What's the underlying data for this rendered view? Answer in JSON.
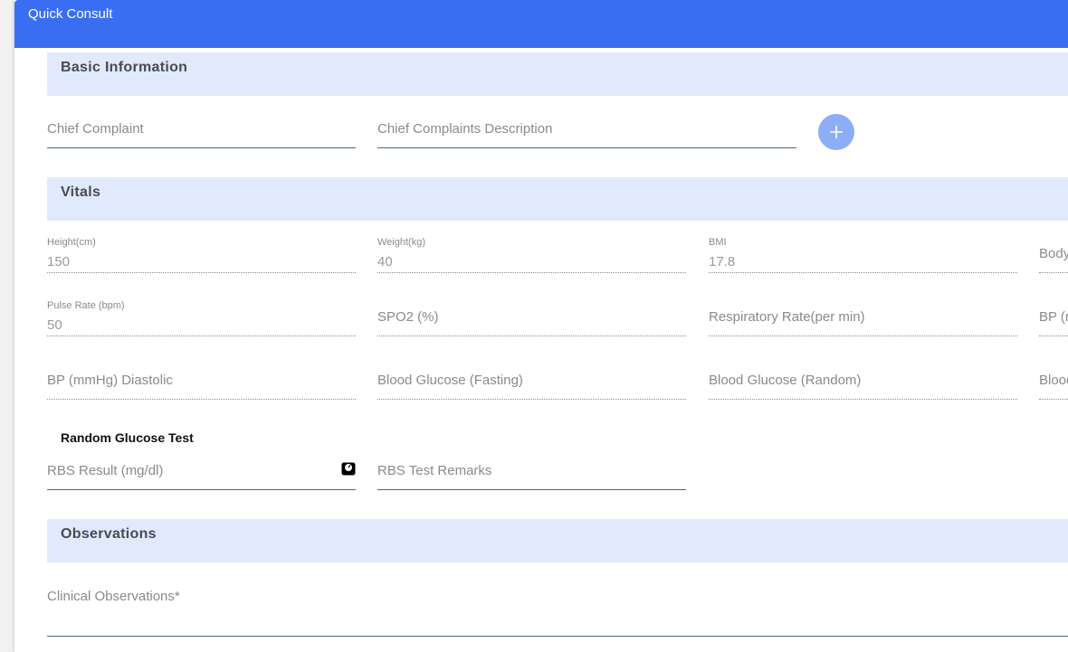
{
  "header": {
    "title": "Quick Consult"
  },
  "sections": {
    "basic": "Basic Information",
    "vitals": "Vitals",
    "observations": "Observations"
  },
  "basic": {
    "chief_complaint_placeholder": "Chief Complaint",
    "chief_complaint_desc_placeholder": "Chief Complaints Description",
    "add_icon": "plus-icon"
  },
  "vitals": {
    "height": {
      "label": "Height(cm)",
      "value": "150"
    },
    "weight": {
      "label": "Weight(kg)",
      "value": "40"
    },
    "bmi": {
      "label": "BMI",
      "value": "17.8"
    },
    "body_temp_placeholder": "Body",
    "pulse": {
      "label": "Pulse Rate (bpm)",
      "value": "50"
    },
    "spo2_placeholder": "SPO2 (%)",
    "resp_rate_placeholder": "Respiratory Rate(per min)",
    "bp_systolic_placeholder": "BP (m",
    "bp_diastolic_placeholder": "BP (mmHg) Diastolic",
    "glucose_fasting_placeholder": "Blood Glucose (Fasting)",
    "glucose_random_placeholder": "Blood Glucose (Random)",
    "glucose_cut_placeholder": "Blood"
  },
  "random_glucose": {
    "title": "Random Glucose Test",
    "rbs_result_placeholder": "RBS Result (mg/dl)",
    "rbs_remarks_placeholder": "RBS Test Remarks",
    "scale_icon": "weighing-scale-icon"
  },
  "observations": {
    "clinical_label": "Clinical Observations",
    "required_mark": "*"
  }
}
